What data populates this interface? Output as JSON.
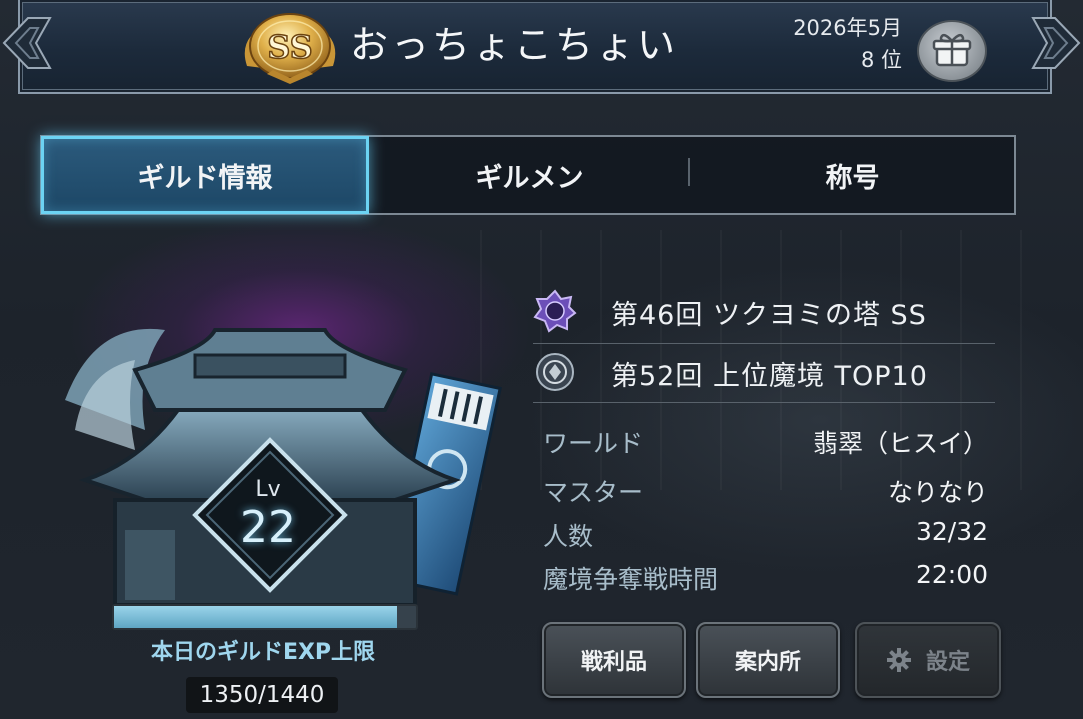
{
  "header": {
    "rank_badge": "SS",
    "player_name": "おっちょこちょい",
    "rank_date": "2026年5月",
    "rank_place": "8 位"
  },
  "tabs": [
    {
      "label": "ギルド情報",
      "active": true
    },
    {
      "label": "ギルメン",
      "active": false
    },
    {
      "label": "称号",
      "active": false
    }
  ],
  "guild": {
    "level_label": "Lv",
    "level": "22",
    "exp_label": "本日のギルドEXP上限",
    "exp_value": "1350/1440",
    "exp_progress": 0.9375
  },
  "titles": [
    {
      "badge_icon": "purple-crest-icon",
      "text": "第46回 ツクヨミの塔 SS"
    },
    {
      "badge_icon": "silver-crest-icon",
      "text": "第52回 上位魔境 TOP10"
    }
  ],
  "info": [
    {
      "label": "ワールド",
      "value": "翡翠（ヒスイ）"
    },
    {
      "label": "マスター",
      "value": "なりなり"
    },
    {
      "label": "人数",
      "value": "32/32"
    },
    {
      "label": "魔境争奪戦時間",
      "value": "22:00"
    }
  ],
  "buttons": {
    "spoils": "戦利品",
    "info_desk": "案内所",
    "settings": "設定"
  },
  "colors": {
    "active_tab_glow": "#6cd3f3",
    "medal_gold": "#d7a93a",
    "label_blue": "#a8bdca"
  }
}
